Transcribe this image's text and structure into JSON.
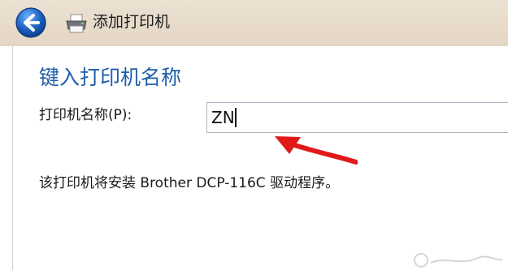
{
  "window": {
    "title": "添加打印机"
  },
  "icons": {
    "back": "back-arrow-icon",
    "printer": "printer-icon"
  },
  "main": {
    "heading": "键入打印机名称",
    "printer_name_label": "打印机名称(P):",
    "printer_name_value": "ZN",
    "driver_note": "该打印机将安装 Brother DCP-116C 驱动程序。"
  },
  "colors": {
    "heading": "#1f5ea8",
    "annotation_arrow": "#e0191b",
    "back_button": "#1f63c6"
  }
}
